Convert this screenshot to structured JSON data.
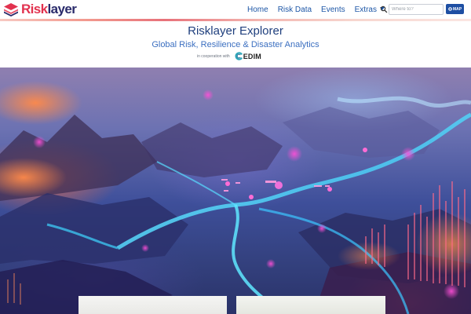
{
  "brand": {
    "name_part1": "Risk",
    "name_part2": "layer",
    "colors": {
      "red": "#e2324f",
      "navy": "#2a2b6b",
      "link": "#1d56a6"
    }
  },
  "nav": {
    "items": [
      {
        "label": "Home"
      },
      {
        "label": "Risk Data"
      },
      {
        "label": "Events"
      },
      {
        "label": "Extras"
      }
    ],
    "search": {
      "icon": "search-icon",
      "placeholder": "Where to?"
    },
    "map_button": {
      "label": "MAP",
      "icon": "globe-icon"
    }
  },
  "header": {
    "title": "Risklayer Explorer",
    "subtitle": "Global Risk, Resilience & Disaster Analytics",
    "cooperation_text": "in cooperation with",
    "partner": "EDIM"
  },
  "hero": {
    "image": "abstract-3d-risk-terrain-map"
  }
}
